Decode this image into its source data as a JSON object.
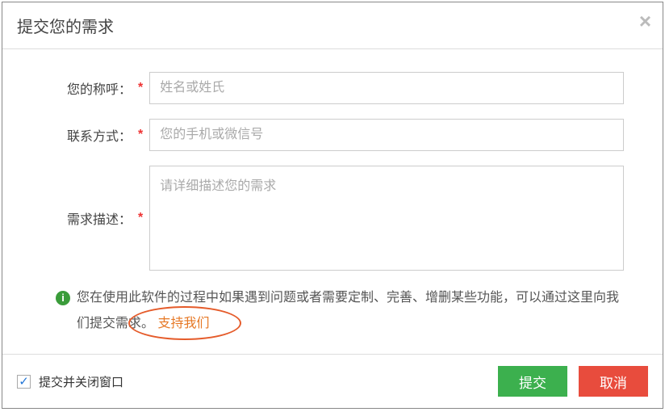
{
  "header": {
    "title": "提交您的需求",
    "close": "×"
  },
  "form": {
    "name": {
      "label": "您的称呼：",
      "placeholder": "姓名或姓氏"
    },
    "contact": {
      "label": "联系方式：",
      "placeholder": "您的手机或微信号"
    },
    "desc": {
      "label": "需求描述：",
      "placeholder": "请详细描述您的需求"
    }
  },
  "hint": {
    "icon": "i",
    "text_before": "您在使用此软件的过程中如果遇到问题或者需要定制、完善、增删某些功能，可以通过这里向我们提交需求。",
    "support_link": "支持我们"
  },
  "footer": {
    "checkbox_label": "提交并关闭窗口",
    "submit": "提交",
    "cancel": "取消"
  }
}
